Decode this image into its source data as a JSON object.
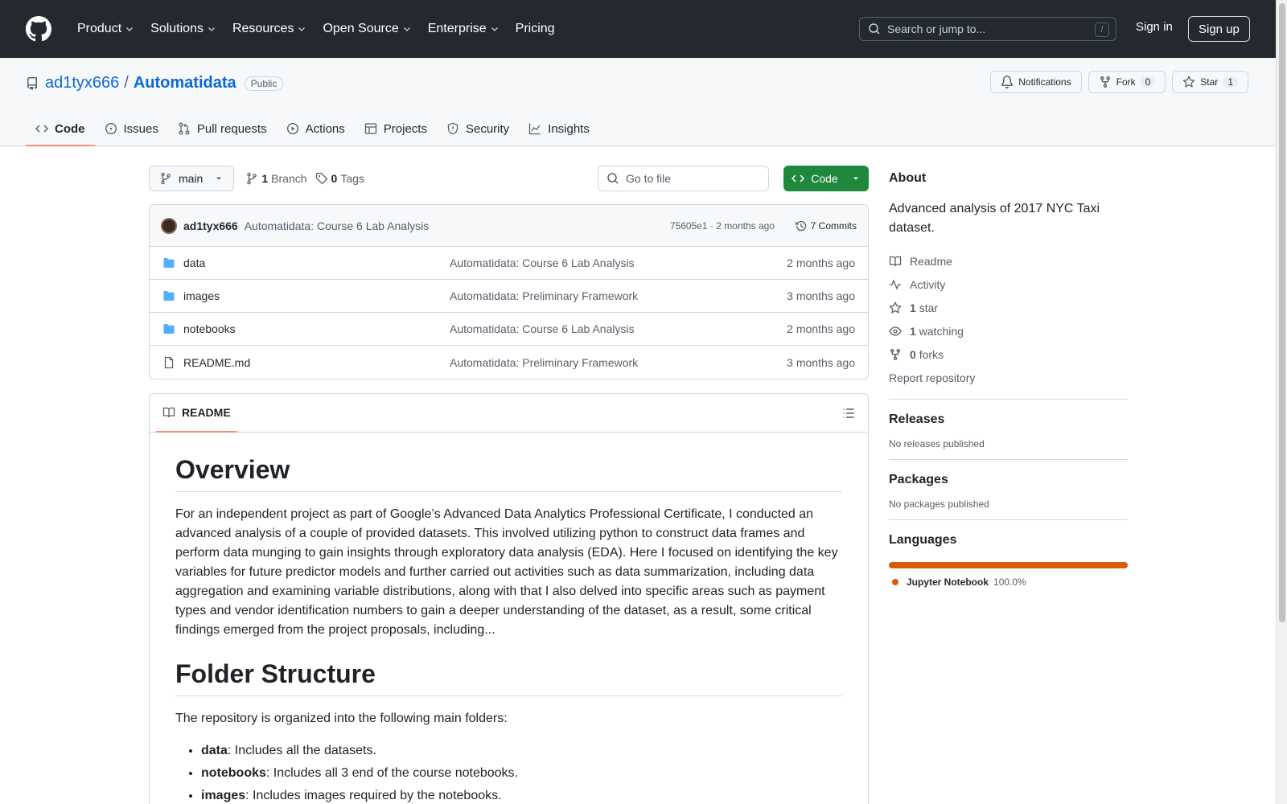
{
  "header": {
    "nav": [
      {
        "label": "Product",
        "dropdown": true
      },
      {
        "label": "Solutions",
        "dropdown": true
      },
      {
        "label": "Resources",
        "dropdown": true
      },
      {
        "label": "Open Source",
        "dropdown": true
      },
      {
        "label": "Enterprise",
        "dropdown": true
      },
      {
        "label": "Pricing",
        "dropdown": false
      }
    ],
    "search_placeholder": "Search or jump to...",
    "search_shortcut": "/",
    "signin": "Sign in",
    "signup": "Sign up"
  },
  "repo": {
    "owner": "ad1tyx666",
    "separator": "/",
    "name": "Automatidata",
    "visibility": "Public",
    "notifications_label": "Notifications",
    "fork_label": "Fork",
    "fork_count": "0",
    "star_label": "Star",
    "star_count": "1",
    "tabs": [
      {
        "label": "Code",
        "icon": "code-icon",
        "active": true
      },
      {
        "label": "Issues",
        "icon": "issue-icon",
        "active": false
      },
      {
        "label": "Pull requests",
        "icon": "pull-request-icon",
        "active": false
      },
      {
        "label": "Actions",
        "icon": "play-icon",
        "active": false
      },
      {
        "label": "Projects",
        "icon": "table-icon",
        "active": false
      },
      {
        "label": "Security",
        "icon": "shield-icon",
        "active": false
      },
      {
        "label": "Insights",
        "icon": "graph-icon",
        "active": false
      }
    ]
  },
  "toolbar": {
    "branch": "main",
    "branch_count": "1",
    "branch_label": "Branch",
    "tag_count": "0",
    "tag_label": "Tags",
    "goto_placeholder": "Go to file",
    "code_button": "Code"
  },
  "commit": {
    "author": "ad1tyx666",
    "message": "Automatidata: Course 6 Lab Analysis",
    "hash_time": "75605e1 · 2 months ago",
    "commits_label": "7 Commits"
  },
  "files": [
    {
      "name": "data",
      "type": "folder",
      "message": "Automatidata: Course 6 Lab Analysis",
      "date": "2 months ago"
    },
    {
      "name": "images",
      "type": "folder",
      "message": "Automatidata: Preliminary Framework",
      "date": "3 months ago"
    },
    {
      "name": "notebooks",
      "type": "folder",
      "message": "Automatidata: Course 6 Lab Analysis",
      "date": "2 months ago"
    },
    {
      "name": "README.md",
      "type": "file",
      "message": "Automatidata: Preliminary Framework",
      "date": "3 months ago"
    }
  ],
  "readme": {
    "tab_label": "README",
    "h1_overview": "Overview",
    "overview_text": "For an independent project as part of Google’s Advanced Data Analytics Professional Certificate, I conducted an advanced analysis of a couple of provided datasets. This involved utilizing python to construct data frames and perform data munging to gain insights through exploratory data analysis (EDA). Here I focused on identifying the key variables for future predictor models and further carried out activities such as data summarization, including data aggregation and examining variable distributions, along with that I also delved into specific areas such as payment types and vendor identification numbers to gain a deeper understanding of the dataset, as a result, some critical findings emerged from the project proposals, including...",
    "h1_folder": "Folder Structure",
    "folder_intro": "The repository is organized into the following main folders:",
    "folders": [
      {
        "name": "data",
        "desc": ": Includes all the datasets."
      },
      {
        "name": "notebooks",
        "desc": ": Includes all 3 end of the course notebooks."
      },
      {
        "name": "images",
        "desc": ": Includes images required by the notebooks."
      }
    ]
  },
  "about": {
    "title": "About",
    "description": "Advanced analysis of 2017 NYC Taxi dataset.",
    "readme": "Readme",
    "activity": "Activity",
    "stars_count": "1",
    "stars_label": "star",
    "watching_count": "1",
    "watching_label": "watching",
    "forks_count": "0",
    "forks_label": "forks",
    "report": "Report repository"
  },
  "releases": {
    "title": "Releases",
    "text": "No releases published"
  },
  "packages": {
    "title": "Packages",
    "text": "No packages published"
  },
  "languages": {
    "title": "Languages",
    "items": [
      {
        "name": "Jupyter Notebook",
        "percent": "100.0%",
        "color": "#da5b0b"
      }
    ]
  }
}
